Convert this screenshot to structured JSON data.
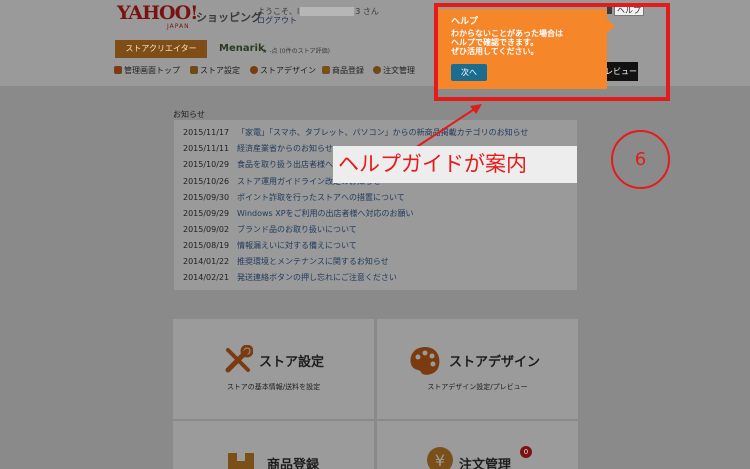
{
  "header": {
    "logo_main": "YAHOO!",
    "logo_sub": "JAPAN",
    "shopping": "ショッピング",
    "welcome_prefix": "ようこそ、",
    "welcome_initial": "l",
    "welcome_suffix": "さん",
    "welcome_trail": "3",
    "logout": "ログアウト",
    "help_link": "ヘルプ"
  },
  "store_bar": {
    "creator_button": "ストアクリエイター",
    "store_name": "Menarik",
    "store_rating": "-点 (0件のストア評価)"
  },
  "nav": {
    "items": [
      {
        "label": "管理画面トップ",
        "icon": "home-icon"
      },
      {
        "label": "ストア設定",
        "icon": "tools-icon"
      },
      {
        "label": "ストアデザイン",
        "icon": "palette-icon"
      },
      {
        "label": "商品登録",
        "icon": "box-icon"
      },
      {
        "label": "注文管理",
        "icon": "yen-icon"
      }
    ],
    "preview": "プレビュー"
  },
  "news": {
    "title": "お知らせ",
    "items": [
      {
        "date": "2015/11/17",
        "text": "「家電」「スマホ、タブレット、パソコン」からの新商品掲載カテゴリのお知らせ"
      },
      {
        "date": "2015/11/11",
        "text": "経済産業省からのお知らせ"
      },
      {
        "date": "2015/10/29",
        "text": "食品を取り扱う出店者様へのお知らせ"
      },
      {
        "date": "2015/10/26",
        "text": "ストア運用ガイドライン改定のお知らせ"
      },
      {
        "date": "2015/09/30",
        "text": "ポイント詐取を行ったストアへの措置について"
      },
      {
        "date": "2015/09/29",
        "text": "Windows XPをご利用の出店者様へ対応のお願い"
      },
      {
        "date": "2015/09/02",
        "text": "ブランド品のお取り扱いについて"
      },
      {
        "date": "2015/08/19",
        "text": "情報漏えいに対する備えについて"
      },
      {
        "date": "2014/01/22",
        "text": "推奨環境とメンテナンスに関するお知らせ"
      },
      {
        "date": "2014/02/21",
        "text": "発送連絡ボタンの押し忘れにご注意ください"
      }
    ]
  },
  "tiles": {
    "store_settings": {
      "title": "ストア設定",
      "sub": "ストアの基本情報/送料を設定"
    },
    "store_design": {
      "title": "ストアデザイン",
      "sub": "ストアデザイン設定/プレビュー"
    },
    "products": {
      "title": "商品登録"
    },
    "orders": {
      "title": "注文管理",
      "badge": "0"
    }
  },
  "help_popup": {
    "title": "ヘルプ",
    "body": "わからないことがあった場合は\nヘルプで確認できます。\nぜひ活用してください。",
    "next": "次へ"
  },
  "annotation": {
    "label": "ヘルプガイドが案内",
    "step": "6"
  },
  "colors": {
    "overlay_gray": "#8a8a8a",
    "popup_orange": "#f5862a",
    "annotation_red": "#e41b1b",
    "next_button": "#1a6d8f"
  }
}
